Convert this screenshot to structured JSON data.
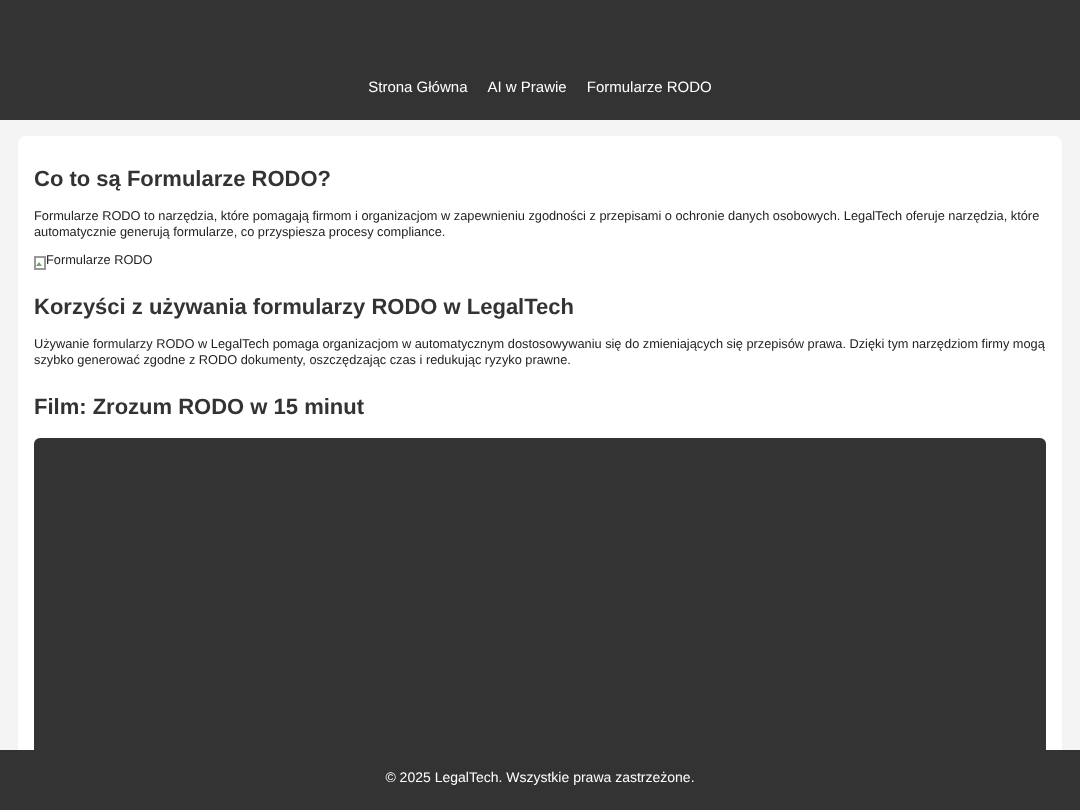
{
  "nav": [
    {
      "label": "Strona Główna"
    },
    {
      "label": "AI w Prawie"
    },
    {
      "label": "Formularze RODO"
    }
  ],
  "sections": [
    {
      "kind": "text",
      "heading": "Co to są Formularze RODO?",
      "paragraph": "Formularze RODO to narzędzia, które pomagają firmom i organizacjom w zapewnieniu zgodności z przepisami o ochronie danych osobowych. LegalTech oferuje narzędzia, które automatycznie generują formularze, co przyspiesza procesy compliance.",
      "image_alt": "Formularze RODO"
    },
    {
      "kind": "text",
      "heading": "Korzyści z używania formularzy RODO w LegalTech",
      "paragraph": "Używanie formularzy RODO w LegalTech pomaga organizacjom w automatycznym dostosowywaniu się do zmieniających się przepisów prawa. Dzięki tym narzędziom firmy mogą szybko generować zgodne z RODO dokumenty, oszczędzając czas i redukując ryzyko prawne."
    },
    {
      "kind": "video",
      "heading": "Film: Zrozum RODO w 15 minut"
    }
  ],
  "footer": "© 2025 LegalTech. Wszystkie prawa zastrzeżone."
}
